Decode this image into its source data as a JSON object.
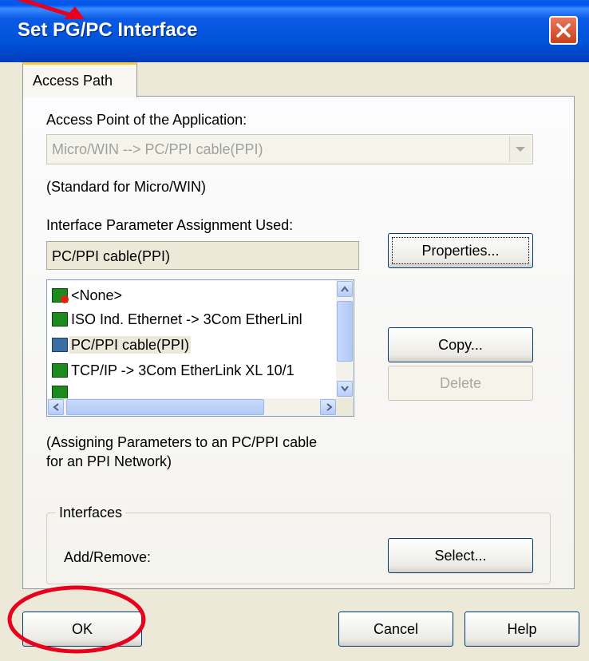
{
  "window": {
    "title": "Set PG/PC Interface"
  },
  "tab": {
    "label": "Access Path"
  },
  "access_point": {
    "label": "Access Point of the Application:",
    "value": "Micro/WIN      --> PC/PPI cable(PPI)",
    "description": "(Standard for Micro/WIN)"
  },
  "interface_param": {
    "label": "Interface Parameter Assignment Used:",
    "value": "PC/PPI cable(PPI)"
  },
  "buttons": {
    "properties": "Properties...",
    "copy": "Copy...",
    "delete": "Delete",
    "select": "Select...",
    "ok": "OK",
    "cancel": "Cancel",
    "help": "Help"
  },
  "list": {
    "items": [
      {
        "label": "<None>",
        "icon": "network-none-icon"
      },
      {
        "label": "ISO Ind. Ethernet -> 3Com EtherLinl",
        "icon": "network-card-icon"
      },
      {
        "label": "PC/PPI cable(PPI)",
        "icon": "ppi-cable-icon",
        "selected": true
      },
      {
        "label": "TCP/IP -> 3Com EtherLink XL 10/1",
        "icon": "network-card-icon"
      }
    ]
  },
  "description": {
    "line1": "(Assigning Parameters to an PC/PPI cable",
    "line2": "for an PPI Network)"
  },
  "interfaces": {
    "title": "Interfaces",
    "add_remove_label": "Add/Remove:"
  },
  "colors": {
    "titlebar": "#0a5ae6",
    "dialog_bg": "#ece9d8",
    "annotation": "#e8001c"
  }
}
